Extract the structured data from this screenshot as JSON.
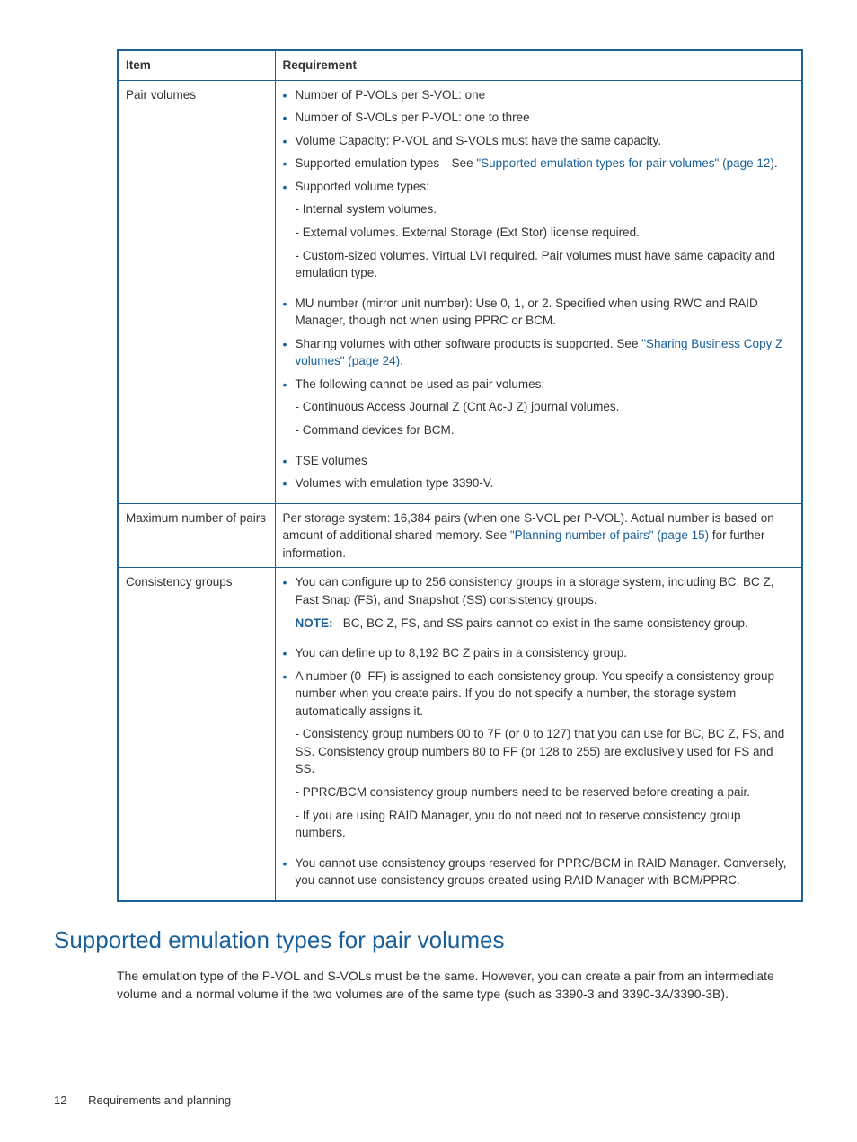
{
  "table": {
    "headers": {
      "item": "Item",
      "requirement": "Requirement"
    },
    "rows": {
      "pair_volumes": {
        "item": "Pair volumes",
        "bullets": {
          "pvol_per_svol": "Number of P-VOLs per S-VOL: one",
          "svol_per_pvol": "Number of S-VOLs per P-VOL: one to three",
          "vol_capacity": "Volume Capacity: P-VOL and S-VOLs must have the same capacity.",
          "emu_pre": "Supported emulation types—See ",
          "emu_link": "\"Supported emulation types for pair volumes\" (page 12)",
          "emu_post": ".",
          "sup_vol_types": "Supported volume types:",
          "sub_internal": "- Internal system volumes.",
          "sub_external": "- External volumes. External Storage (Ext Stor) license required.",
          "sub_custom": "- Custom-sized volumes. Virtual LVI required. Pair volumes must have same capacity and emulation type.",
          "mu_number": "MU number (mirror unit number): Use 0, 1, or 2. Specified when using RWC and RAID Manager, though not when using PPRC or BCM.",
          "sharing_pre": "Sharing volumes with other software products is supported. See ",
          "sharing_link": "\"Sharing Business Copy Z volumes\" (page 24)",
          "sharing_post": ".",
          "cannot_pair": "The following cannot be used as pair volumes:",
          "sub_cajz": "- Continuous Access Journal Z (Cnt Ac-J Z) journal volumes.",
          "sub_cmd": "- Command devices for BCM.",
          "tse": "TSE volumes",
          "emu3390v": "Volumes with emulation type 3390-V."
        }
      },
      "max_pairs": {
        "item": "Maximum number of pairs",
        "text_pre": "Per storage system: 16,384 pairs (when one S-VOL per P-VOL). Actual number is based on amount of additional shared memory. See ",
        "text_link": "\"Planning number of pairs\" (page 15)",
        "text_post": " for further information."
      },
      "consistency": {
        "item": "Consistency groups",
        "b1": "You can configure up to 256 consistency groups in a storage system, including BC, BC Z, Fast Snap (FS), and Snapshot (SS) consistency groups.",
        "note_label": "NOTE:",
        "note_text": "BC, BC Z, FS, and SS pairs cannot co-exist in the same consistency group.",
        "b2": "You can define up to 8,192 BC Z pairs in a consistency group.",
        "b3": "A number (0–FF) is assigned to each consistency group. You specify a consistency group number when you create pairs. If you do not specify a number, the storage system automatically assigns it.",
        "sub1": "- Consistency group numbers 00 to 7F (or 0 to 127) that you can use for BC, BC Z, FS, and SS. Consistency group numbers 80 to FF (or 128 to 255) are exclusively used for FS and SS.",
        "sub2": "- PPRC/BCM consistency group numbers need to be reserved before creating a pair.",
        "sub3": "- If you are using RAID Manager, you do not need not to reserve consistency group numbers.",
        "b4": "You cannot use consistency groups reserved for PPRC/BCM in RAID Manager. Conversely, you cannot use consistency groups created using RAID Manager with BCM/PPRC."
      }
    }
  },
  "section": {
    "heading": "Supported emulation types for pair volumes",
    "paragraph": "The emulation type of the P-VOL and S-VOLs must be the same. However, you can create a pair from an intermediate volume and a normal volume if the two volumes are of the same type (such as 3390-3 and 3390-3A/3390-3B)."
  },
  "footer": {
    "page": "12",
    "chapter": "Requirements and planning"
  }
}
